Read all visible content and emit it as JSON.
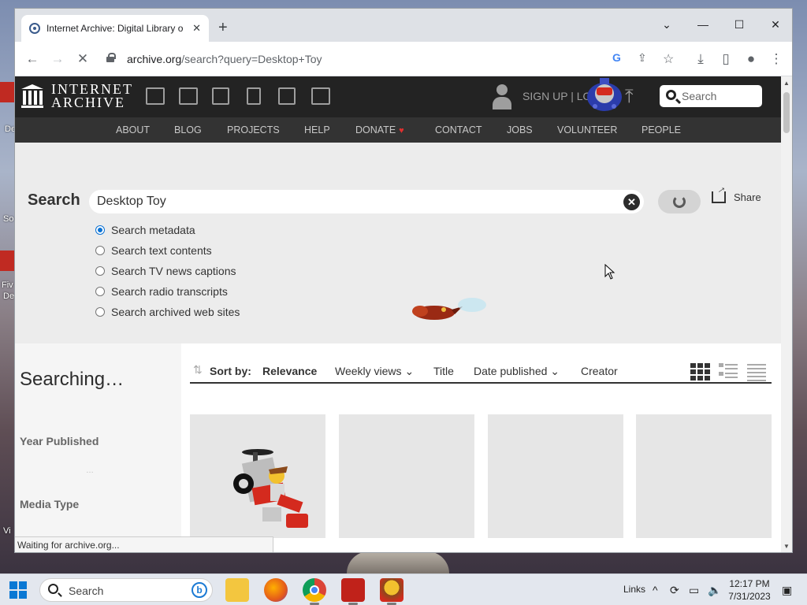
{
  "desktop": {
    "labels": [
      "De",
      "So",
      "Fiv",
      "De",
      "Vi"
    ]
  },
  "browser": {
    "tab_title": "Internet Archive: Digital Library o",
    "new_tab_label": "+",
    "url_host": "archive.org",
    "url_path": "/search?query=Desktop+Toy",
    "status": "Waiting for archive.org..."
  },
  "ia": {
    "wordmark_line1": "INTERNET",
    "wordmark_line2": "ARCHIVE",
    "signup": "SIGN UP | LO",
    "search_placeholder": "Search",
    "nav": [
      "ABOUT",
      "BLOG",
      "PROJECTS",
      "HELP",
      "DONATE",
      "CONTACT",
      "JOBS",
      "VOLUNTEER",
      "PEOPLE"
    ],
    "heart": "♥"
  },
  "search": {
    "label": "Search",
    "query": "Desktop Toy",
    "share_label": "Share",
    "options": [
      {
        "label": "Search metadata",
        "checked": true
      },
      {
        "label": "Search text contents",
        "checked": false
      },
      {
        "label": "Search TV news captions",
        "checked": false
      },
      {
        "label": "Search radio transcripts",
        "checked": false
      },
      {
        "label": "Search archived web sites",
        "checked": false
      }
    ]
  },
  "results": {
    "status": "Searching…",
    "facets": [
      "Year Published",
      "Media Type"
    ],
    "facet_dots": "…",
    "sort_label": "Sort by:",
    "sort_options": [
      "Relevance",
      "Weekly views",
      "Title",
      "Date published",
      "Creator"
    ]
  },
  "taskbar": {
    "search_text": "Search",
    "links": "Links",
    "time": "12:17 PM",
    "date": "7/31/2023"
  },
  "colors": {
    "ia_header": "#232323",
    "ia_nav": "#333333",
    "accent_blue": "#0b72d4"
  }
}
